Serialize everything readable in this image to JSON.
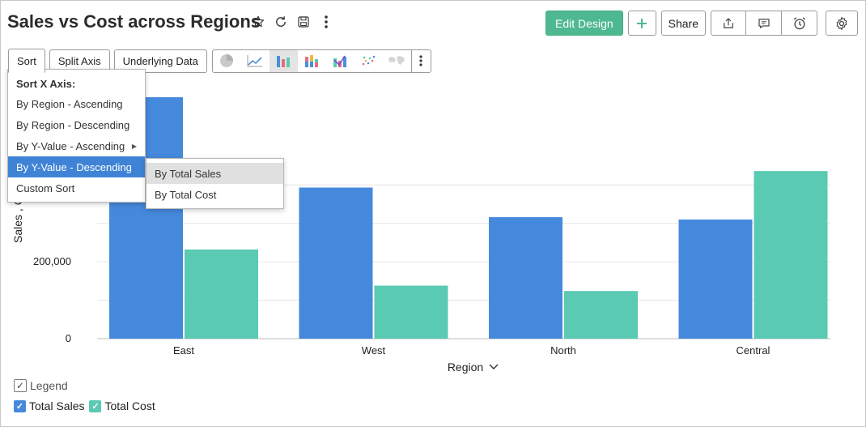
{
  "header": {
    "title": "Sales vs Cost across Regions",
    "icons": [
      "star-icon",
      "refresh-icon",
      "save-icon",
      "more-vertical-icon"
    ]
  },
  "actions": {
    "edit_design": "Edit Design",
    "add_icon": "plus-icon",
    "share": "Share",
    "group_icons": [
      "export-icon",
      "comment-icon",
      "alarm-icon"
    ],
    "settings_icon": "gear-icon"
  },
  "toolbar": {
    "sort": "Sort",
    "split_axis": "Split Axis",
    "underlying_data": "Underlying Data",
    "chart_types": [
      "pie-chart-icon",
      "line-chart-icon",
      "bar-chart-icon",
      "stacked-bar-chart-icon",
      "combo-chart-icon",
      "scatter-chart-icon",
      "map-chart-icon",
      "more-vertical-icon"
    ],
    "selected_chart_type": "bar-chart-icon"
  },
  "sort_menu": {
    "heading": "Sort X Axis:",
    "items": [
      "By Region - Ascending",
      "By Region - Descending",
      "By Y-Value - Ascending",
      "By Y-Value - Descending",
      "Custom Sort"
    ],
    "highlighted": "By Y-Value - Descending",
    "submenu": [
      "By Total Sales",
      "By Total Cost"
    ],
    "submenu_hover": "By Total Sales"
  },
  "colors": {
    "total_sales": "#4589dc",
    "total_cost": "#5acab2",
    "accent": "#4eb891"
  },
  "chart_data": {
    "type": "bar",
    "categories": [
      "East",
      "West",
      "North",
      "Central"
    ],
    "series": [
      {
        "name": "Total Sales",
        "values": [
          628000,
          393000,
          316000,
          310000
        ]
      },
      {
        "name": "Total Cost",
        "values": [
          232000,
          138000,
          124000,
          436000
        ]
      }
    ],
    "xlabel": "Region",
    "ylabel": "Sales , C",
    "ylim": [
      0,
      628000
    ],
    "y_ticks": [
      0,
      200000
    ],
    "y_tick_labels": [
      "0",
      "200,000"
    ],
    "grid": true
  },
  "legend": {
    "toggle_label": "Legend",
    "toggle_checked": "✓",
    "items": [
      "Total Sales",
      "Total Cost"
    ]
  }
}
